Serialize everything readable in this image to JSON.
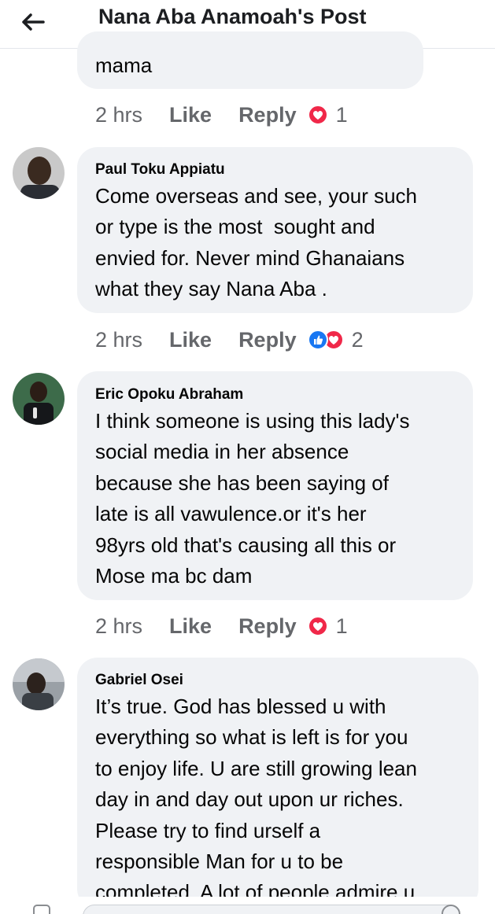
{
  "header": {
    "title": "Nana Aba Anamoah's Post"
  },
  "comments": [
    {
      "text": "mama",
      "time": "2 hrs",
      "like_label": "Like",
      "reply_label": "Reply",
      "reaction_count": "1"
    },
    {
      "author": "Paul Toku Appiatu",
      "text": "Come overseas and see, your such\nor type is the most  sought and\nenvied for. Never mind Ghanaians\nwhat they say Nana Aba .",
      "time": "2 hrs",
      "like_label": "Like",
      "reply_label": "Reply",
      "reaction_count": "2"
    },
    {
      "author": "Eric Opoku Abraham",
      "text": "I think someone is using this lady's\nsocial media in her absence\nbecause she has been saying of\nlate is all vawulence.or it's her\n98yrs old that's causing all this or\nMose ma bc dam",
      "time": "2 hrs",
      "like_label": "Like",
      "reply_label": "Reply",
      "reaction_count": "1"
    },
    {
      "author": "Gabriel Osei",
      "text": "It’s true. God has blessed u with\neverything so what is left is for you\nto enjoy life. U are still growing lean\nday in and day out upon ur riches.\nPlease try to find urself a\nresponsible Man for u to be\ncompleted. A lot of people admire u"
    }
  ],
  "colors": {
    "bubble_bg": "#f0f2f5",
    "action_text": "#65676b",
    "love_reaction": "#f02849",
    "like_reaction": "#1877f2"
  },
  "icons": {
    "back": "arrow-left-icon",
    "love": "heart-icon",
    "like": "thumbs-up-icon"
  }
}
